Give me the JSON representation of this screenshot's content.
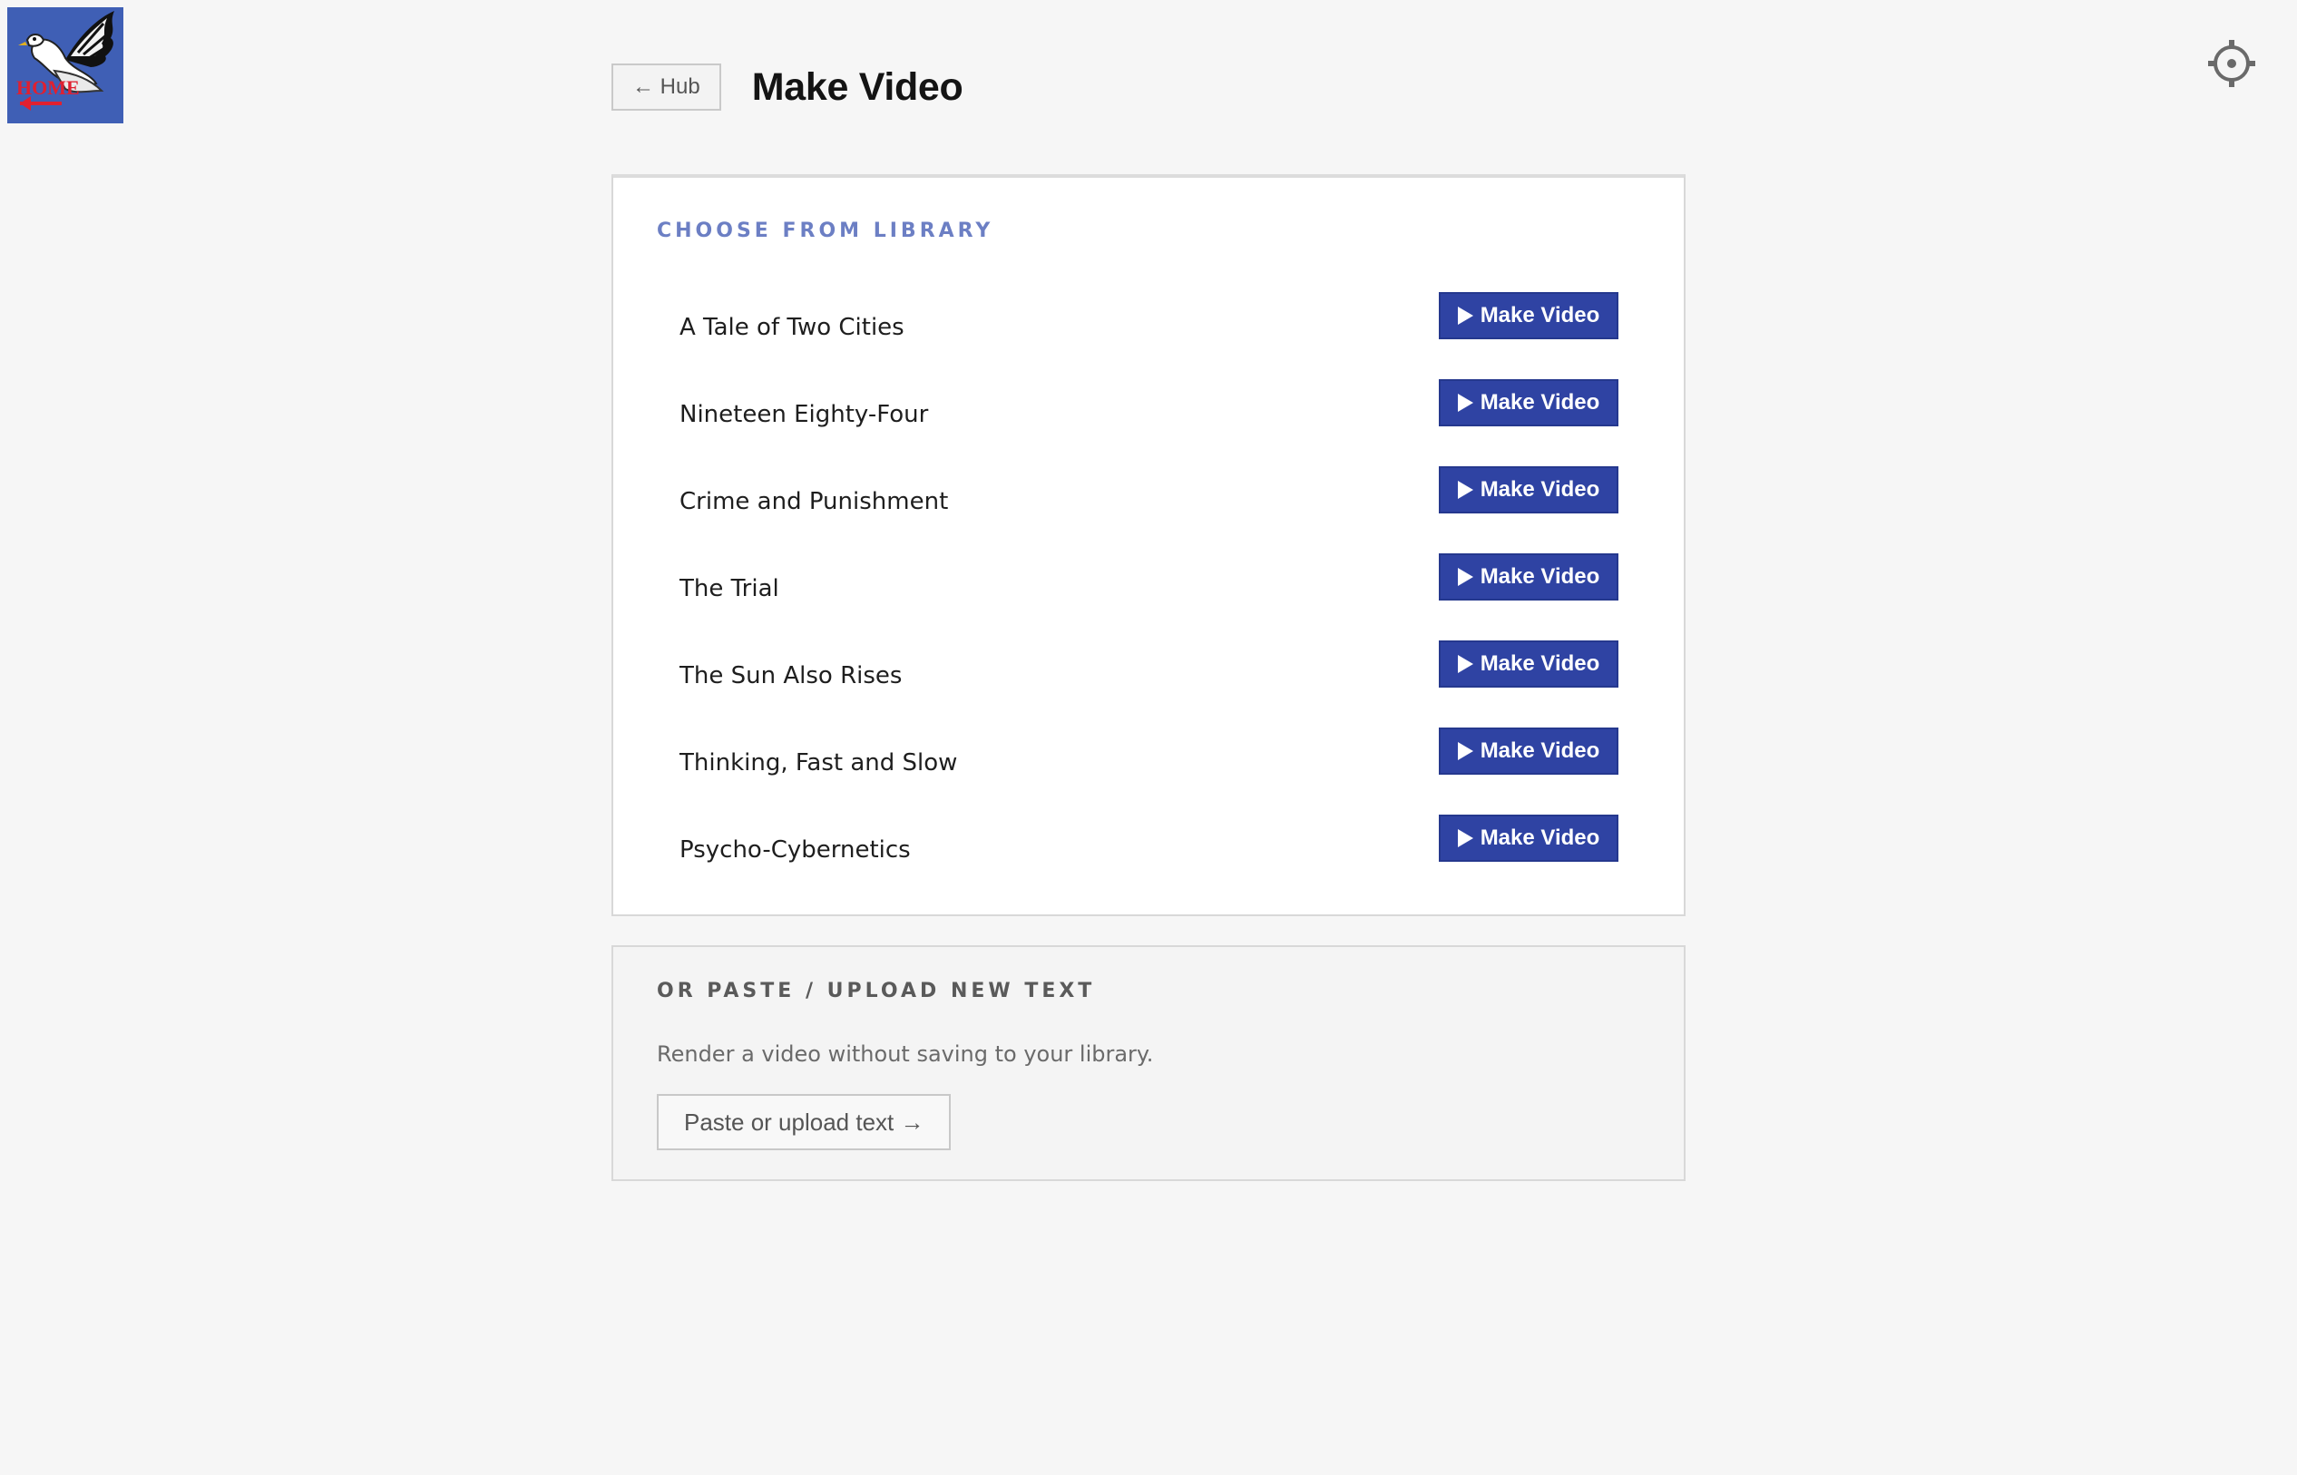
{
  "header": {
    "logo_text": "HOME",
    "back_label": "← Hub",
    "title": "Make Video",
    "settings_icon": "gear-icon"
  },
  "library": {
    "section_title": "CHOOSE FROM LIBRARY",
    "button_label": "Make Video",
    "button_icon": "play-icon",
    "books": [
      {
        "title": "A Tale of Two Cities"
      },
      {
        "title": "Nineteen Eighty-Four"
      },
      {
        "title": "Crime and Punishment"
      },
      {
        "title": "The Trial"
      },
      {
        "title": "The Sun Also Rises"
      },
      {
        "title": "Thinking, Fast and Slow"
      },
      {
        "title": "Psycho-Cybernetics"
      }
    ]
  },
  "upload": {
    "section_title": "OR PASTE / UPLOAD NEW TEXT",
    "description": "Render a video without saving to your library.",
    "button_label": "Paste or upload text →"
  },
  "colors": {
    "accent": "#2f43a3",
    "section_title_accent": "#6c7fc4",
    "logo_background": "#3f5fb5",
    "logo_text": "#e02030"
  }
}
